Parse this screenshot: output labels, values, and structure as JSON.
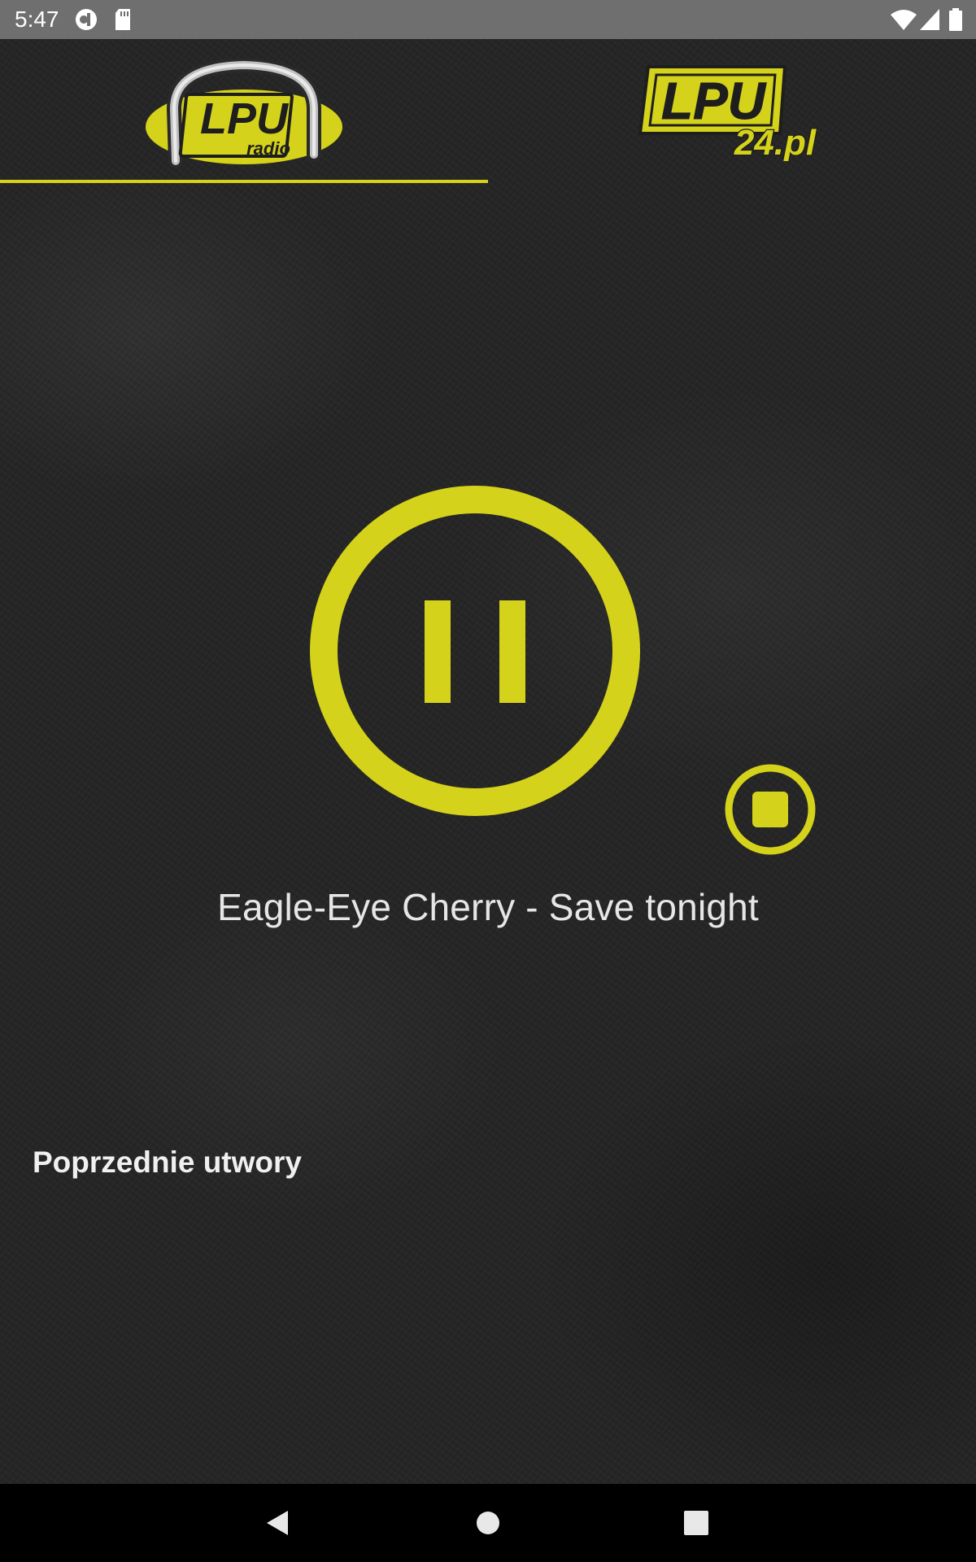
{
  "status_bar": {
    "time": "5:47",
    "icons": [
      "vpn-key-icon",
      "sd-card-icon",
      "wifi-icon",
      "signal-icon",
      "battery-icon"
    ]
  },
  "header": {
    "logo_left": {
      "main": "LPU",
      "sub": "radio"
    },
    "logo_right": {
      "main": "LPU",
      "sub": "24.pl"
    }
  },
  "player": {
    "state": "playing",
    "now_playing": "Eagle-Eye Cherry - Save tonight",
    "toggle_icon": "pause-icon",
    "stop_icon": "stop-icon"
  },
  "history": {
    "title": "Poprzednie utwory"
  },
  "navigation": {
    "buttons": [
      "back-icon",
      "home-icon",
      "recents-icon"
    ]
  },
  "colors": {
    "accent": "#d4d21a",
    "background": "#252525",
    "text": "#e6e6e6",
    "status_bar": "#6f6f6f",
    "nav_bar": "#000000"
  }
}
